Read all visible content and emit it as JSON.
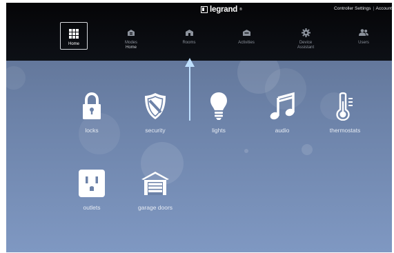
{
  "header": {
    "brand": "legrand",
    "brand_mark": "®",
    "links": [
      "Controller Settings",
      "Account"
    ],
    "link_separator": "|"
  },
  "nav": {
    "items": [
      {
        "label": "Home",
        "sub": "",
        "icon": "grid-icon",
        "active": true
      },
      {
        "label": "Modes",
        "sub": "Home",
        "icon": "modes-icon",
        "active": false
      },
      {
        "label": "Rooms",
        "sub": "",
        "icon": "rooms-icon",
        "active": false
      },
      {
        "label": "Activities",
        "sub": "",
        "icon": "activities-icon",
        "active": false
      },
      {
        "label": "Device",
        "sub": "Assistant",
        "icon": "gear-icon",
        "active": false
      },
      {
        "label": "Users",
        "sub": "",
        "icon": "users-icon",
        "active": false
      }
    ]
  },
  "devices": [
    {
      "label": "locks",
      "icon": "lock-icon"
    },
    {
      "label": "security",
      "icon": "shield-icon"
    },
    {
      "label": "lights",
      "icon": "bulb-icon"
    },
    {
      "label": "audio",
      "icon": "music-note-icon"
    },
    {
      "label": "thermostats",
      "icon": "thermometer-icon"
    },
    {
      "label": "outlets",
      "icon": "outlet-icon"
    },
    {
      "label": "garage doors",
      "icon": "garage-door-icon"
    }
  ],
  "colors": {
    "topbar": "#050507",
    "background_top": "#5b6d8e",
    "background_bottom": "#7f98c2",
    "icon": "#ffffff",
    "arrow": "#bfe0ff"
  }
}
